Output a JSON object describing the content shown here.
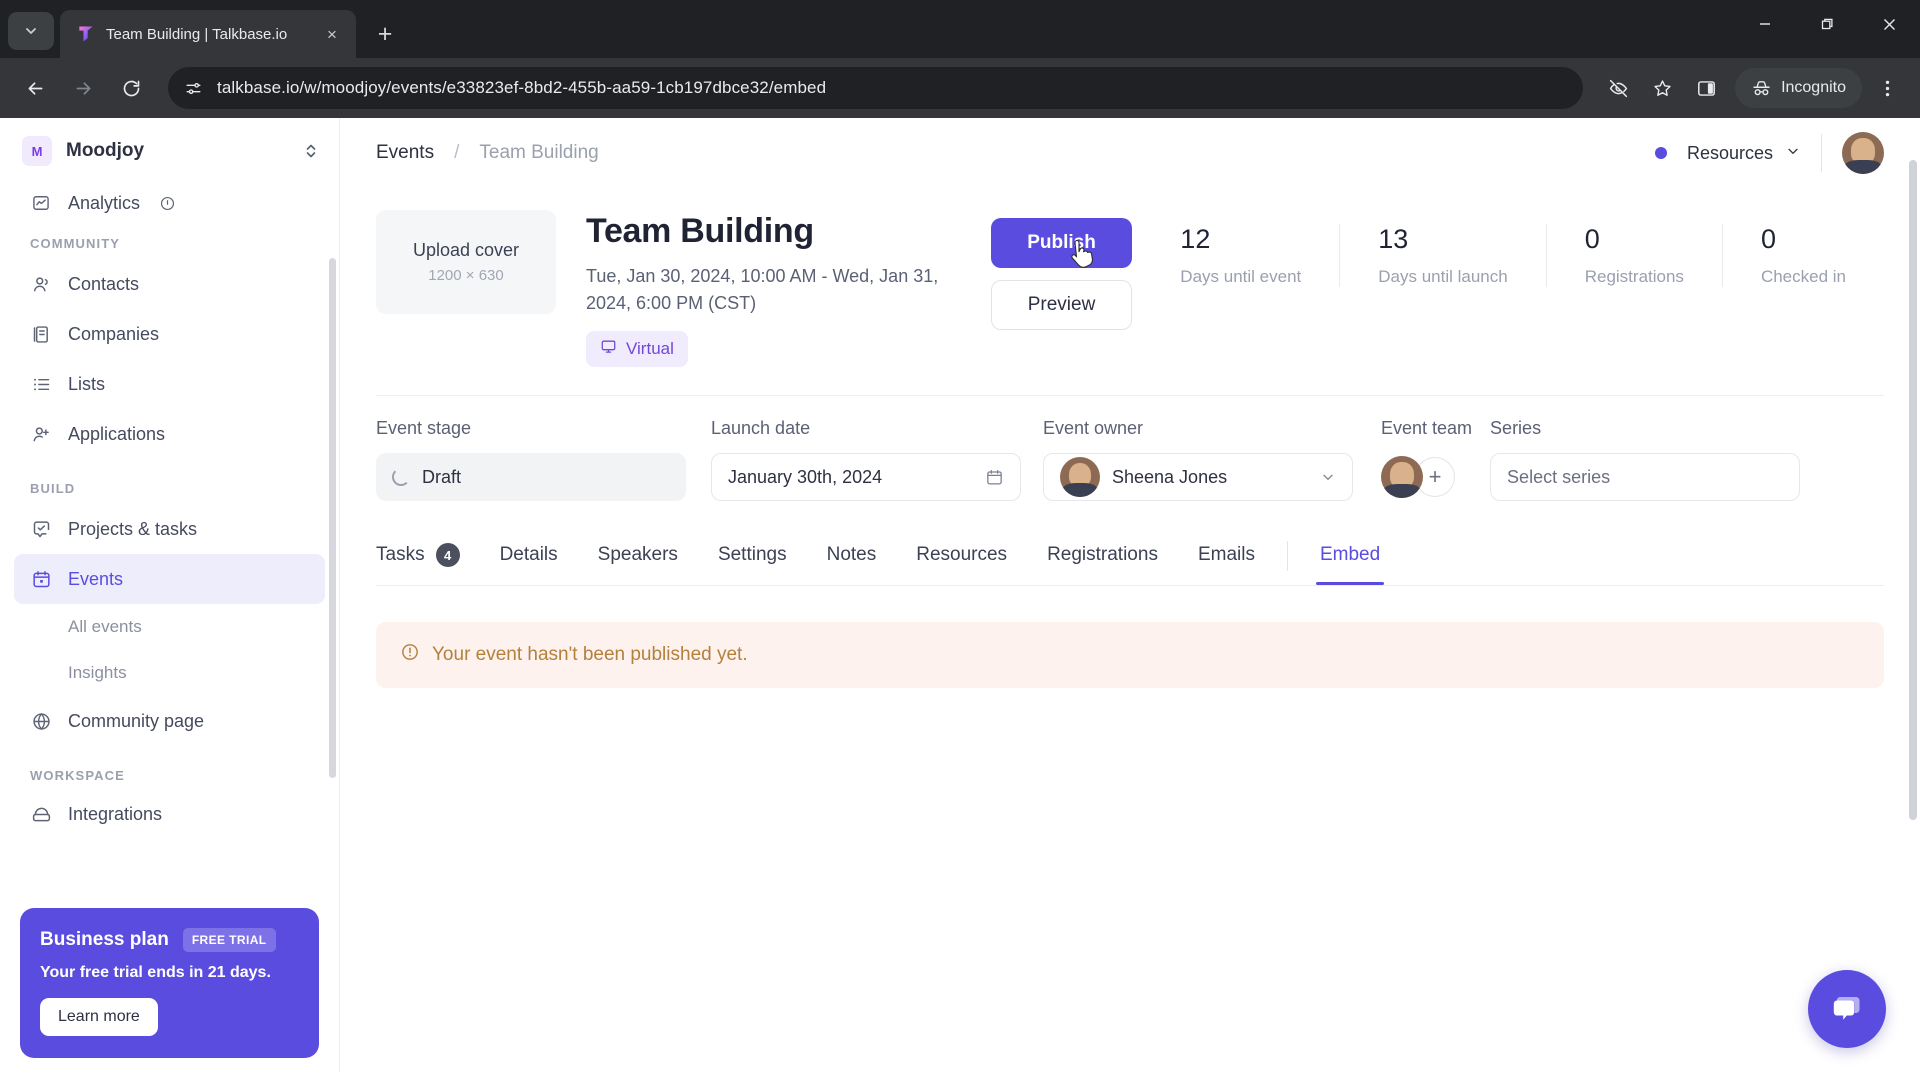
{
  "browser": {
    "tab": {
      "title": "Team Building | Talkbase.io",
      "favicon": "talkbase-logo-icon",
      "close": "×"
    },
    "new_tab_label": "+",
    "window_controls": {
      "minimize": "minimize-icon",
      "maximize": "maximize-icon",
      "close": "close-icon"
    },
    "nav": {
      "back": "back-arrow-icon",
      "forward": "forward-arrow-icon",
      "reload": "reload-icon"
    },
    "omnibox": {
      "site_settings_icon": "site-settings-icon",
      "url": "talkbase.io/w/moodjoy/events/e33823ef-8bd2-455b-aa59-1cb197dbce32/embed"
    },
    "toolbar": {
      "tracking_protection_icon": "eye-off-icon",
      "bookmark_icon": "star-icon",
      "side_panel_icon": "side-panel-icon",
      "profile_label": "Incognito",
      "profile_icon": "incognito-hat-icon",
      "menu_icon": "three-dot-menu-icon"
    }
  },
  "sidebar": {
    "workspace": {
      "initial": "M",
      "name": "Moodjoy",
      "switch_icon": "chevron-updown-icon"
    },
    "clipped_top": {
      "label": "Analytics",
      "icon": "analytics-chart-icon",
      "badge_icon": "info-icon"
    },
    "groups": [
      {
        "label": "COMMUNITY",
        "items": [
          {
            "label": "Contacts",
            "icon": "contacts-icon"
          },
          {
            "label": "Companies",
            "icon": "companies-building-icon"
          },
          {
            "label": "Lists",
            "icon": "list-icon"
          },
          {
            "label": "Applications",
            "icon": "user-plus-icon"
          }
        ]
      },
      {
        "label": "BUILD",
        "items": [
          {
            "label": "Projects & tasks",
            "icon": "checkbox-task-icon"
          },
          {
            "label": "Events",
            "icon": "calendar-icon",
            "active": true
          },
          {
            "label": "All events",
            "sub": true
          },
          {
            "label": "Insights",
            "sub": true
          },
          {
            "label": "Community page",
            "icon": "globe-icon"
          }
        ]
      },
      {
        "label": "WORKSPACE",
        "items": [
          {
            "label": "Integrations",
            "icon": "integrations-icon",
            "clipped": true
          }
        ]
      }
    ],
    "plan_card": {
      "title": "Business plan",
      "badge": "FREE TRIAL",
      "subtitle": "Your free trial ends in 21 days.",
      "button": "Learn more"
    }
  },
  "topbar": {
    "breadcrumb": {
      "root": "Events",
      "separator": "/",
      "current": "Team Building"
    },
    "status_dot_color": "#5b4ce0",
    "resources_label": "Resources",
    "resources_chevron": "chevron-down-icon",
    "avatar": "user-avatar"
  },
  "event": {
    "cover": {
      "title": "Upload cover",
      "dimensions": "1200 × 630"
    },
    "title": "Team Building",
    "date": "Tue, Jan 30, 2024, 10:00 AM - Wed, Jan 31, 2024, 6:00 PM (CST)",
    "tag": {
      "label": "Virtual",
      "icon": "monitor-icon"
    },
    "actions": {
      "publish": "Publish",
      "preview": "Preview"
    },
    "stats": [
      {
        "value": "12",
        "label": "Days until event"
      },
      {
        "value": "13",
        "label": "Days until launch"
      },
      {
        "value": "0",
        "label": "Registrations"
      },
      {
        "value": "0",
        "label": "Checked in"
      }
    ],
    "fields": {
      "stage": {
        "label": "Event stage",
        "value": "Draft",
        "icon": "spinner-icon"
      },
      "launch": {
        "label": "Launch date",
        "value": "January 30th, 2024",
        "icon": "calendar-icon"
      },
      "owner": {
        "label": "Event owner",
        "value": "Sheena Jones",
        "chevron": "chevron-down-icon"
      },
      "team": {
        "label": "Event team",
        "add": "+"
      },
      "series": {
        "label": "Series",
        "placeholder": "Select series"
      }
    }
  },
  "tabs": [
    {
      "label": "Tasks",
      "count": "4"
    },
    {
      "label": "Details"
    },
    {
      "label": "Speakers"
    },
    {
      "label": "Settings"
    },
    {
      "label": "Notes"
    },
    {
      "label": "Resources"
    },
    {
      "label": "Registrations"
    },
    {
      "label": "Emails"
    },
    {
      "label": "Embed",
      "active": true
    }
  ],
  "alert": {
    "icon": "info-circle-icon",
    "message": "Your event hasn't been published yet."
  },
  "chat": {
    "icon": "chat-bubble-icon"
  },
  "colors": {
    "accent": "#5b4ce0",
    "alert_text": "#b4803c",
    "alert_bg": "#fdf2ee"
  }
}
